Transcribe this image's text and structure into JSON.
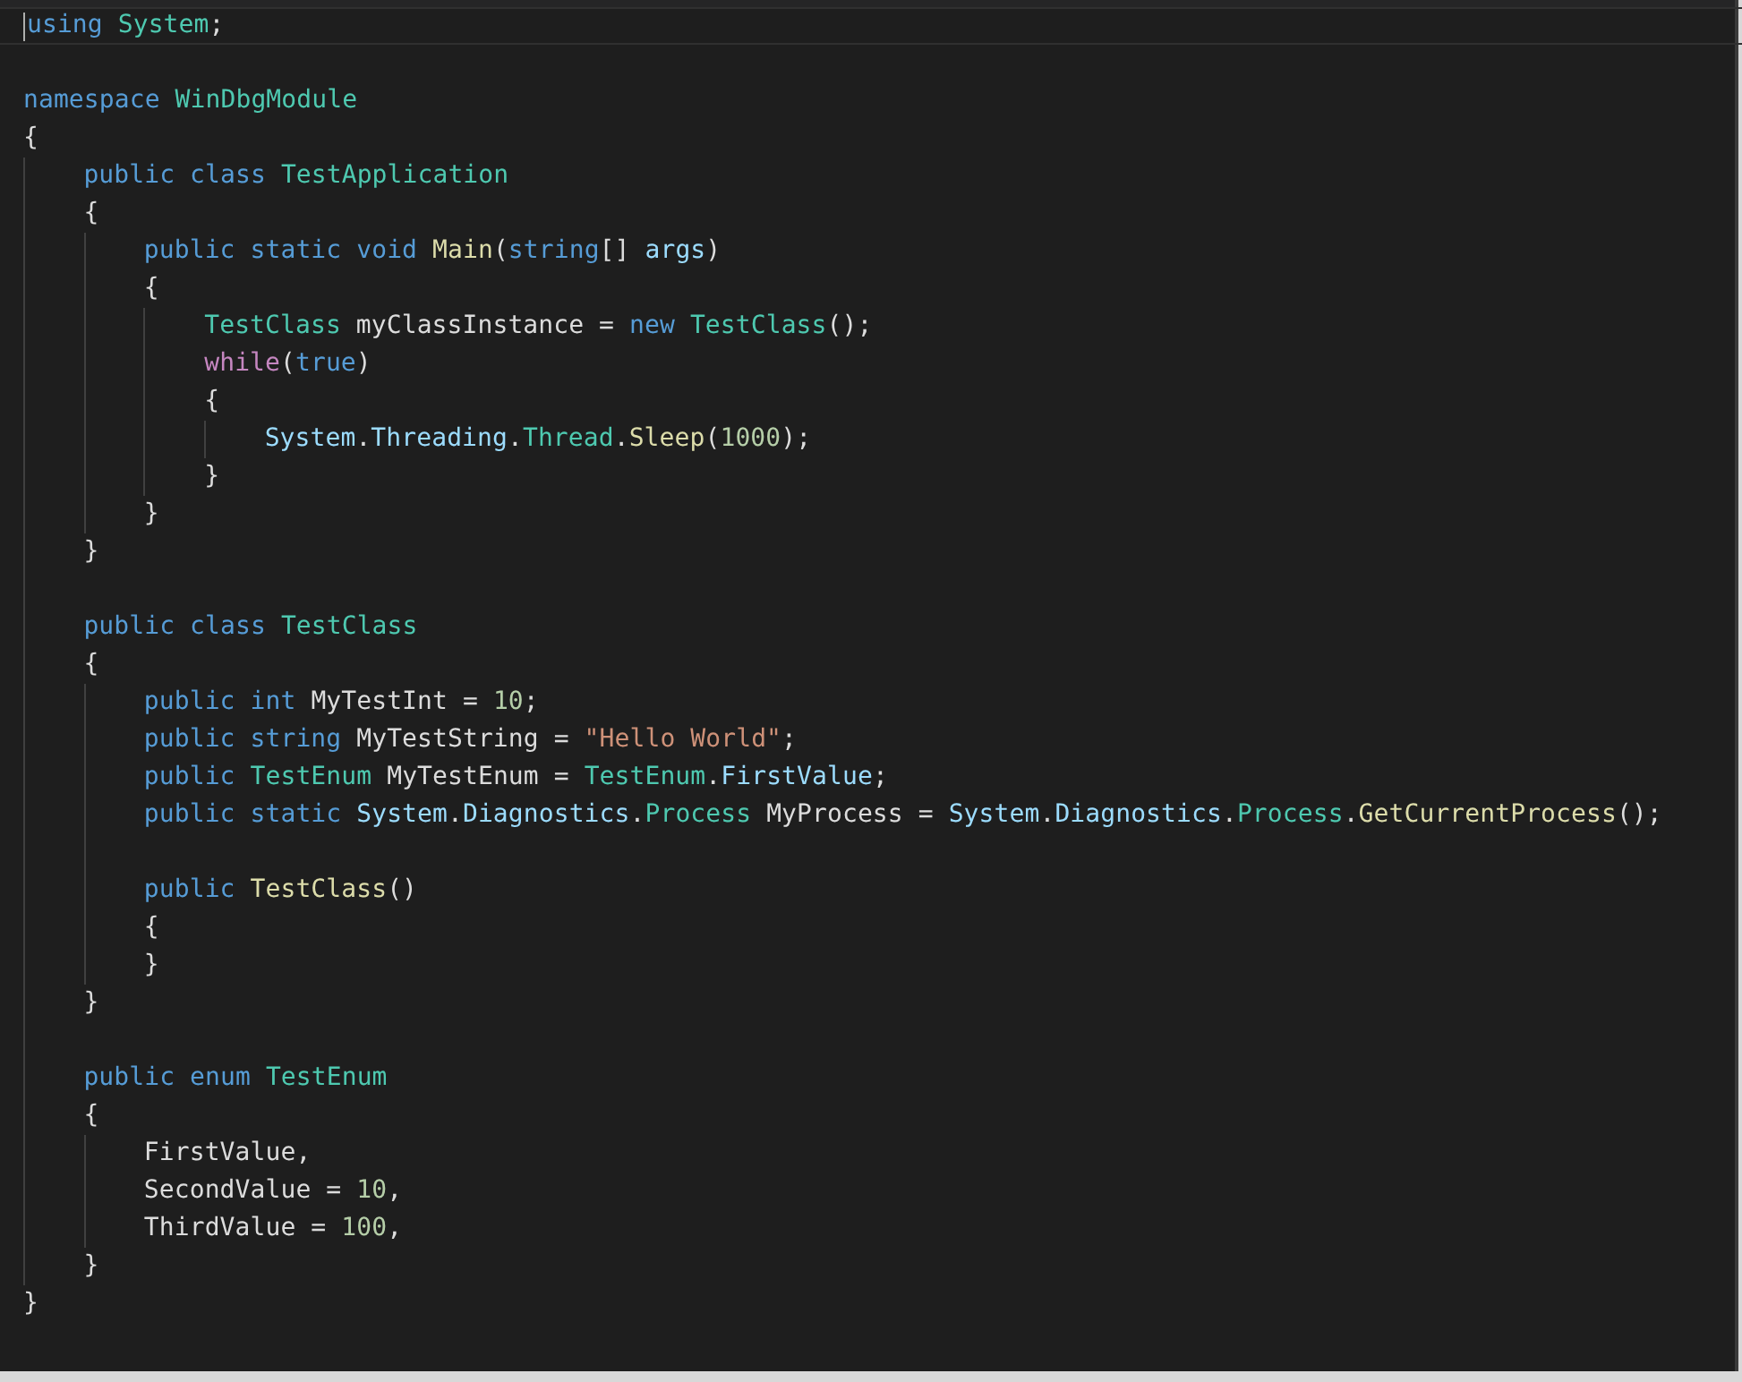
{
  "editor": {
    "lines": [
      {
        "current": true,
        "tokens": [
          {
            "kind": "keyword",
            "text": "using "
          },
          {
            "kind": "type",
            "text": "System"
          },
          {
            "kind": "plain",
            "text": ";"
          }
        ]
      },
      {
        "current": false
      },
      {
        "current": false,
        "tokens": [
          {
            "kind": "keyword",
            "text": "namespace "
          },
          {
            "kind": "type",
            "text": "WinDbgModule"
          }
        ]
      },
      {
        "current": false,
        "tokens": [
          {
            "kind": "plain",
            "text": "{"
          }
        ]
      },
      {
        "children": [
          {
            "current": false,
            "tokens": [
              {
                "kind": "keyword",
                "text": "public class "
              },
              {
                "kind": "type",
                "text": "TestApplication"
              }
            ]
          },
          {
            "current": false,
            "tokens": [
              {
                "kind": "plain",
                "text": "{"
              }
            ]
          },
          {
            "children": [
              {
                "current": false,
                "tokens": [
                  {
                    "kind": "keyword",
                    "text": "public static void "
                  },
                  {
                    "kind": "method",
                    "text": "Main"
                  },
                  {
                    "kind": "plain",
                    "text": "("
                  },
                  {
                    "kind": "keyword",
                    "text": "string"
                  },
                  {
                    "kind": "plain",
                    "text": "[] "
                  },
                  {
                    "kind": "variable",
                    "text": "args"
                  },
                  {
                    "kind": "plain",
                    "text": ")"
                  }
                ]
              },
              {
                "current": false,
                "tokens": [
                  {
                    "kind": "plain",
                    "text": "{"
                  }
                ]
              },
              {
                "children": [
                  {
                    "current": false,
                    "tokens": [
                      {
                        "kind": "type",
                        "text": "TestClass"
                      },
                      {
                        "kind": "plain",
                        "text": " myClassInstance = "
                      },
                      {
                        "kind": "keyword",
                        "text": "new "
                      },
                      {
                        "kind": "type",
                        "text": "TestClass"
                      },
                      {
                        "kind": "plain",
                        "text": "();"
                      }
                    ]
                  },
                  {
                    "current": false,
                    "tokens": [
                      {
                        "kind": "control",
                        "text": "while"
                      },
                      {
                        "kind": "plain",
                        "text": "("
                      },
                      {
                        "kind": "keyword",
                        "text": "true"
                      },
                      {
                        "kind": "plain",
                        "text": ")"
                      }
                    ]
                  },
                  {
                    "current": false,
                    "tokens": [
                      {
                        "kind": "plain",
                        "text": "{"
                      }
                    ]
                  },
                  {
                    "children": [
                      {
                        "current": false,
                        "tokens": [
                          {
                            "kind": "variable",
                            "text": "System"
                          },
                          {
                            "kind": "plain",
                            "text": "."
                          },
                          {
                            "kind": "variable",
                            "text": "Threading"
                          },
                          {
                            "kind": "plain",
                            "text": "."
                          },
                          {
                            "kind": "type",
                            "text": "Thread"
                          },
                          {
                            "kind": "plain",
                            "text": "."
                          },
                          {
                            "kind": "method",
                            "text": "Sleep"
                          },
                          {
                            "kind": "plain",
                            "text": "("
                          },
                          {
                            "kind": "number",
                            "text": "1000"
                          },
                          {
                            "kind": "plain",
                            "text": ");"
                          }
                        ]
                      }
                    ]
                  },
                  {
                    "current": false,
                    "tokens": [
                      {
                        "kind": "plain",
                        "text": "}"
                      }
                    ]
                  }
                ]
              },
              {
                "current": false,
                "tokens": [
                  {
                    "kind": "plain",
                    "text": "}"
                  }
                ]
              }
            ]
          },
          {
            "current": false,
            "tokens": [
              {
                "kind": "plain",
                "text": "}"
              }
            ]
          },
          {
            "current": false
          },
          {
            "current": false,
            "tokens": [
              {
                "kind": "keyword",
                "text": "public class "
              },
              {
                "kind": "type",
                "text": "TestClass"
              }
            ]
          },
          {
            "current": false,
            "tokens": [
              {
                "kind": "plain",
                "text": "{"
              }
            ]
          },
          {
            "children": [
              {
                "current": false,
                "tokens": [
                  {
                    "kind": "keyword",
                    "text": "public int "
                  },
                  {
                    "kind": "plain",
                    "text": "MyTestInt = "
                  },
                  {
                    "kind": "number",
                    "text": "10"
                  },
                  {
                    "kind": "plain",
                    "text": ";"
                  }
                ]
              },
              {
                "current": false,
                "tokens": [
                  {
                    "kind": "keyword",
                    "text": "public string "
                  },
                  {
                    "kind": "plain",
                    "text": "MyTestString = "
                  },
                  {
                    "kind": "string",
                    "text": "\"Hello World\""
                  },
                  {
                    "kind": "plain",
                    "text": ";"
                  }
                ]
              },
              {
                "current": false,
                "tokens": [
                  {
                    "kind": "keyword",
                    "text": "public "
                  },
                  {
                    "kind": "type",
                    "text": "TestEnum"
                  },
                  {
                    "kind": "plain",
                    "text": " MyTestEnum = "
                  },
                  {
                    "kind": "type",
                    "text": "TestEnum"
                  },
                  {
                    "kind": "plain",
                    "text": "."
                  },
                  {
                    "kind": "variable",
                    "text": "FirstValue"
                  },
                  {
                    "kind": "plain",
                    "text": ";"
                  }
                ]
              },
              {
                "current": false,
                "tokens": [
                  {
                    "kind": "keyword",
                    "text": "public static "
                  },
                  {
                    "kind": "variable",
                    "text": "System"
                  },
                  {
                    "kind": "plain",
                    "text": "."
                  },
                  {
                    "kind": "variable",
                    "text": "Diagnostics"
                  },
                  {
                    "kind": "plain",
                    "text": "."
                  },
                  {
                    "kind": "type",
                    "text": "Process"
                  },
                  {
                    "kind": "plain",
                    "text": " MyProcess = "
                  },
                  {
                    "kind": "variable",
                    "text": "System"
                  },
                  {
                    "kind": "plain",
                    "text": "."
                  },
                  {
                    "kind": "variable",
                    "text": "Diagnostics"
                  },
                  {
                    "kind": "plain",
                    "text": "."
                  },
                  {
                    "kind": "type",
                    "text": "Process"
                  },
                  {
                    "kind": "plain",
                    "text": "."
                  },
                  {
                    "kind": "method",
                    "text": "GetCurrentProcess"
                  },
                  {
                    "kind": "plain",
                    "text": "();"
                  }
                ]
              },
              {
                "current": false
              },
              {
                "current": false,
                "tokens": [
                  {
                    "kind": "keyword",
                    "text": "public "
                  },
                  {
                    "kind": "method",
                    "text": "TestClass"
                  },
                  {
                    "kind": "plain",
                    "text": "()"
                  }
                ]
              },
              {
                "current": false,
                "tokens": [
                  {
                    "kind": "plain",
                    "text": "{"
                  }
                ]
              },
              {
                "current": false,
                "tokens": [
                  {
                    "kind": "plain",
                    "text": "}"
                  }
                ]
              }
            ]
          },
          {
            "current": false,
            "tokens": [
              {
                "kind": "plain",
                "text": "}"
              }
            ]
          },
          {
            "current": false
          },
          {
            "current": false,
            "tokens": [
              {
                "kind": "keyword",
                "text": "public enum "
              },
              {
                "kind": "type",
                "text": "TestEnum"
              }
            ]
          },
          {
            "current": false,
            "tokens": [
              {
                "kind": "plain",
                "text": "{"
              }
            ]
          },
          {
            "children": [
              {
                "current": false,
                "tokens": [
                  {
                    "kind": "plain",
                    "text": "FirstValue,"
                  }
                ]
              },
              {
                "current": false,
                "tokens": [
                  {
                    "kind": "plain",
                    "text": "SecondValue = "
                  },
                  {
                    "kind": "number",
                    "text": "10"
                  },
                  {
                    "kind": "plain",
                    "text": ","
                  }
                ]
              },
              {
                "current": false,
                "tokens": [
                  {
                    "kind": "plain",
                    "text": "ThirdValue = "
                  },
                  {
                    "kind": "number",
                    "text": "100"
                  },
                  {
                    "kind": "plain",
                    "text": ","
                  }
                ]
              }
            ]
          },
          {
            "current": false,
            "tokens": [
              {
                "kind": "plain",
                "text": "}"
              }
            ]
          }
        ]
      },
      {
        "current": false,
        "tokens": [
          {
            "kind": "plain",
            "text": "}"
          }
        ]
      }
    ]
  }
}
